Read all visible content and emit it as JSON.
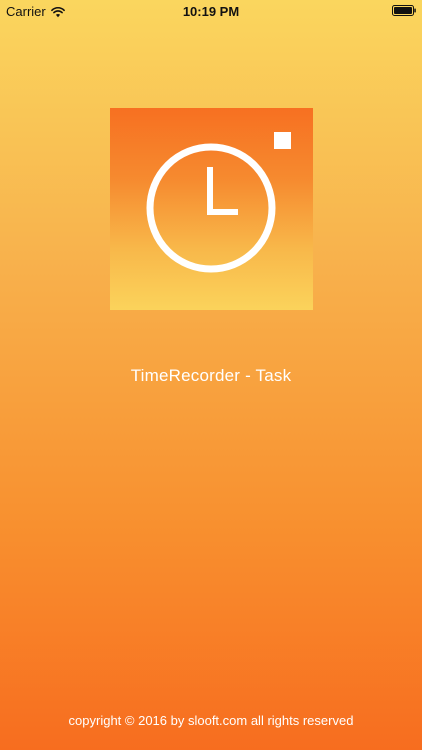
{
  "status_bar": {
    "carrier": "Carrier",
    "time": "10:19 PM",
    "wifi_icon": "wifi-icon",
    "battery_icon": "battery-icon"
  },
  "logo": {
    "icon": "clock-icon",
    "accent_color": "#f77021",
    "highlight_color": "#fbd35b"
  },
  "app": {
    "title": "TimeRecorder - Task"
  },
  "footer": {
    "copyright": "copyright © 2016 by slooft.com all rights reserved"
  },
  "colors": {
    "background_top": "#fad65e",
    "background_bottom": "#f76d1f",
    "text": "#ffffff"
  }
}
